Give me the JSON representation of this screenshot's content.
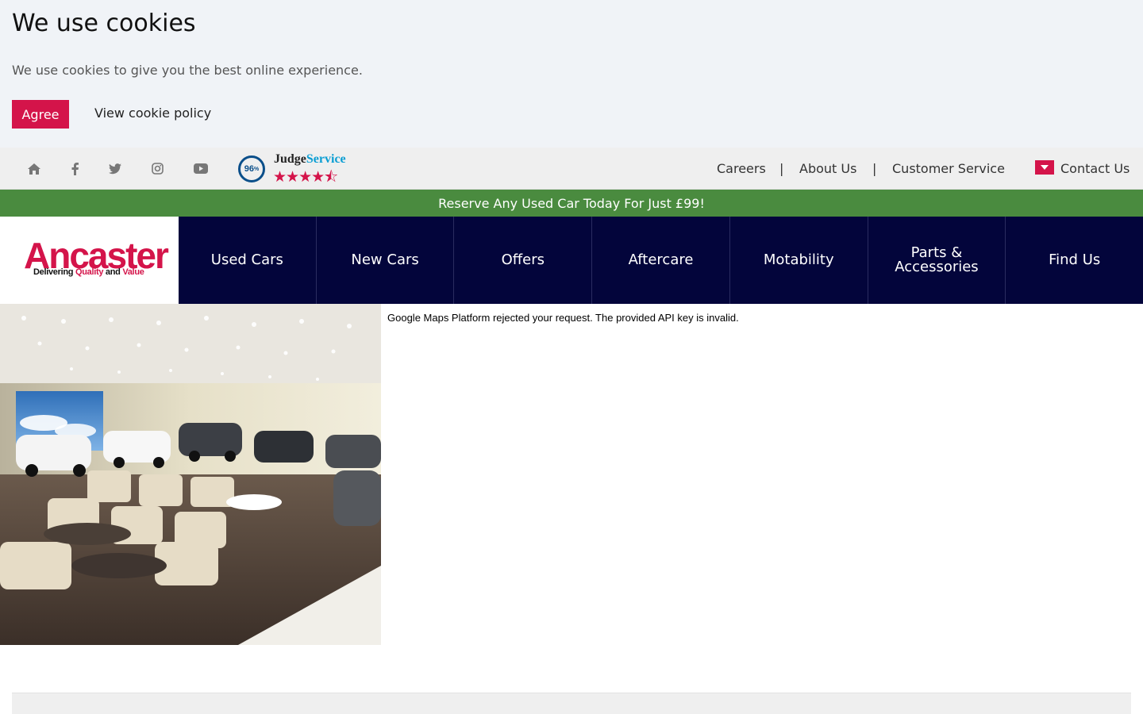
{
  "cookie_banner": {
    "title": "We use cookies",
    "text": "We use cookies to give you the best online experience.",
    "agree_label": "Agree",
    "policy_label": "View cookie policy"
  },
  "utility_bar": {
    "social_icons": [
      "home-icon",
      "facebook-icon",
      "twitter-icon",
      "instagram-icon",
      "youtube-icon"
    ],
    "judge_service": {
      "score": "96",
      "score_suffix": "%",
      "name_part1": "Judge",
      "name_part2": "Service",
      "stars": "★★★★⯪",
      "rating": 4.5
    },
    "links": [
      "Careers",
      "About Us",
      "Customer Service"
    ],
    "separator": "|",
    "contact_label": "Contact Us"
  },
  "promo": {
    "text": "Reserve Any Used Car Today For Just £99!"
  },
  "header": {
    "logo_word": "Ancaster",
    "logo_tag_1": "Delivering ",
    "logo_tag_2": "Quality",
    "logo_tag_3": " and ",
    "logo_tag_4": "Value",
    "nav": [
      "Used Cars",
      "New Cars",
      "Offers",
      "Aftercare",
      "Motability",
      "Parts & Accessories",
      "Find Us"
    ]
  },
  "map": {
    "error": "Google Maps Platform rejected your request. The provided API key is invalid."
  },
  "colors": {
    "brand_red": "#d4144a",
    "navy": "#03053b",
    "promo_green": "#4a8b3f"
  }
}
